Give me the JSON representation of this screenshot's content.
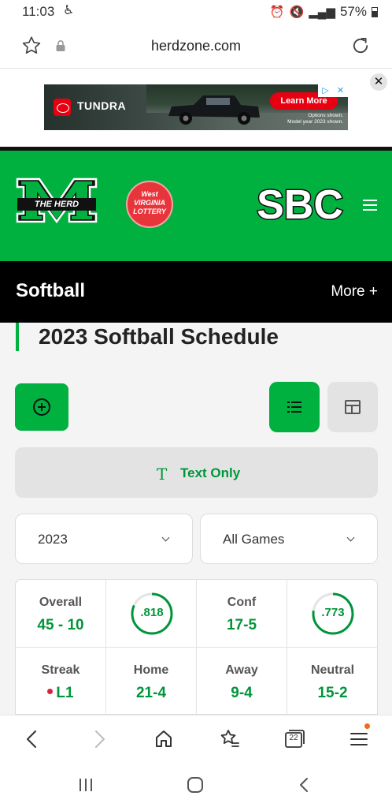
{
  "status_bar": {
    "time": "11:03",
    "battery": "57%"
  },
  "browser": {
    "url": "herdzone.com",
    "tab_count": "22"
  },
  "ad": {
    "brand": "TUNDRA",
    "cta": "Learn More",
    "fine_print_line1": "Options shown.",
    "fine_print_line2": "Model year 2023 shown.",
    "close_label": "✕"
  },
  "site_header": {
    "team_logo_text": "THE HERD",
    "sponsor_logo_line1": "West",
    "sponsor_logo_line2": "VIRGINIA",
    "sponsor_logo_line3": "LOTTERY",
    "conference_logo_text": "SBC"
  },
  "sport_bar": {
    "title": "Softball",
    "more_label": "More +"
  },
  "page": {
    "title": "2023 Softball Schedule",
    "text_only_label": "Text Only",
    "filters": {
      "season": "2023",
      "games": "All Games"
    }
  },
  "record": {
    "overall_label": "Overall",
    "overall_value": "45 - 10",
    "overall_pct": ".818",
    "overall_pct_fraction": 0.818,
    "conf_label": "Conf",
    "conf_value": "17-5",
    "conf_pct": ".773",
    "conf_pct_fraction": 0.773,
    "streak_label": "Streak",
    "streak_value": "L1",
    "home_label": "Home",
    "home_value": "21-4",
    "away_label": "Away",
    "away_value": "9-4",
    "neutral_label": "Neutral",
    "neutral_value": "15-2"
  },
  "colors": {
    "brand_green": "#00b140",
    "text_green": "#00953a",
    "loss_red": "#d8233f",
    "ad_red": "#e60012"
  }
}
